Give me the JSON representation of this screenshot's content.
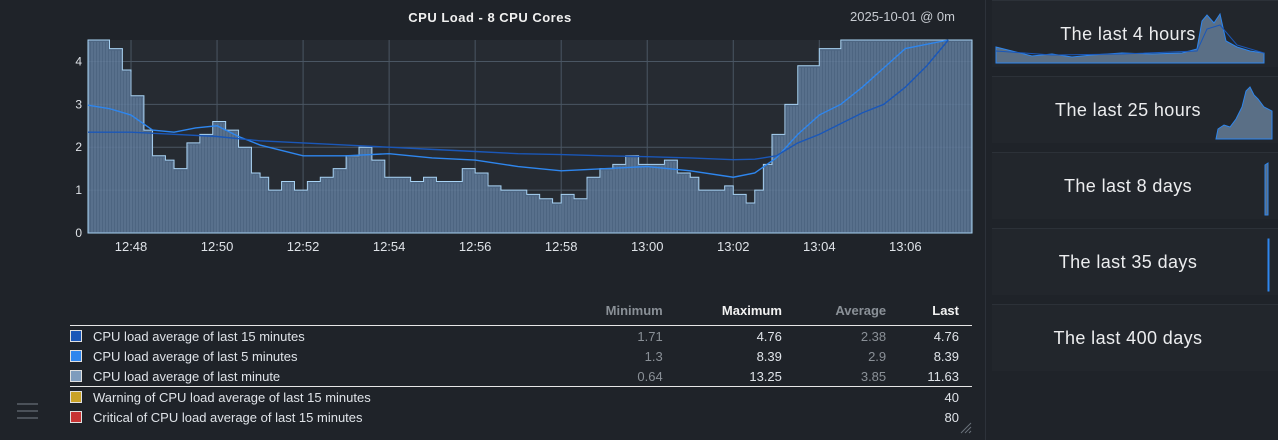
{
  "header": {
    "title": "CPU Load - 8 CPU Cores",
    "timestamp": "2025-10-01 @ 0m"
  },
  "colors": {
    "load15": "#1a57b8",
    "load5": "#2e86ee",
    "load1_line": "#a9d4f5",
    "load1_fill": "#55708f",
    "grid": "#4a5663",
    "warning": "#e2b824",
    "critical": "#d94040"
  },
  "legend": {
    "columns": {
      "name": "",
      "min": "Minimum",
      "max": "Maximum",
      "avg": "Average",
      "last": "Last"
    },
    "rows": [
      {
        "name": "CPU load average of last 15 minutes",
        "min": "1.71",
        "max": "4.76",
        "avg": "2.38",
        "last": "4.76",
        "color": "#1a57b8"
      },
      {
        "name": "CPU load average of last 5 minutes",
        "min": "1.3",
        "max": "8.39",
        "avg": "2.9",
        "last": "8.39",
        "color": "#2e86ee"
      },
      {
        "name": "CPU load average of last minute",
        "min": "0.64",
        "max": "13.25",
        "avg": "3.85",
        "last": "11.63",
        "color": "#7f9cbd"
      }
    ],
    "thresholds": [
      {
        "name": "Warning of CPU load average of last 15 minutes",
        "last": "40",
        "color": "#c9a227"
      },
      {
        "name": "Critical of CPU load average of last 15 minutes",
        "last": "80",
        "color": "#c83434"
      }
    ]
  },
  "side": {
    "periods": [
      {
        "label": "The last 4 hours"
      },
      {
        "label": "The last 25 hours"
      },
      {
        "label": "The last 8 days"
      },
      {
        "label": "The last 35 days"
      },
      {
        "label": "The last 400 days"
      }
    ]
  },
  "chart_data": {
    "type": "area",
    "title": "CPU Load - 8 CPU Cores",
    "xlabel": "",
    "ylabel": "",
    "x_ticks": [
      "12:48",
      "12:50",
      "12:52",
      "12:54",
      "12:56",
      "12:58",
      "13:00",
      "13:02",
      "13:04",
      "13:06"
    ],
    "y_ticks": [
      0,
      1,
      2,
      3,
      4
    ],
    "ylim": [
      0,
      4.5
    ],
    "grid": true,
    "x_unit": "minutes after 12:47",
    "series": [
      {
        "name": "CPU load average of last minute",
        "style": "filled area",
        "x": [
          0,
          0.3,
          0.5,
          0.8,
          1.0,
          1.3,
          1.5,
          1.8,
          2.0,
          2.3,
          2.6,
          2.9,
          3.2,
          3.5,
          3.8,
          4.0,
          4.2,
          4.5,
          4.8,
          5.1,
          5.4,
          5.7,
          6.0,
          6.3,
          6.6,
          6.9,
          7.2,
          7.5,
          7.8,
          8.1,
          8.4,
          8.7,
          9.0,
          9.3,
          9.6,
          9.9,
          10.2,
          10.5,
          10.8,
          11.0,
          11.3,
          11.6,
          11.9,
          12.2,
          12.5,
          12.8,
          13.1,
          13.4,
          13.7,
          14.0,
          14.2,
          14.5,
          14.8,
          15.0,
          15.3,
          15.5,
          15.7,
          15.9,
          16.2,
          16.5,
          17.0,
          17.5,
          18.0,
          19.0,
          20.0,
          20.5
        ],
        "values": [
          4.5,
          4.5,
          4.3,
          3.8,
          3.2,
          2.4,
          1.8,
          1.7,
          1.5,
          2.1,
          2.3,
          2.6,
          2.4,
          2.0,
          1.4,
          1.3,
          1.0,
          1.2,
          1.0,
          1.2,
          1.3,
          1.5,
          1.8,
          2.0,
          1.7,
          1.3,
          1.3,
          1.2,
          1.3,
          1.2,
          1.2,
          1.5,
          1.4,
          1.1,
          1.0,
          1.0,
          0.9,
          0.8,
          0.7,
          0.9,
          0.8,
          1.3,
          1.5,
          1.6,
          1.8,
          1.6,
          1.6,
          1.7,
          1.4,
          1.3,
          1.0,
          1.0,
          1.1,
          0.9,
          0.7,
          1.0,
          1.6,
          2.3,
          3.0,
          3.9,
          4.3,
          4.5,
          4.5,
          4.5,
          4.5,
          4.5
        ]
      },
      {
        "name": "CPU load average of last 5 minutes",
        "style": "line",
        "x": [
          0,
          0.5,
          1.0,
          1.5,
          2.0,
          2.5,
          3.0,
          3.5,
          4.0,
          5.0,
          6.0,
          7.0,
          8.0,
          9.0,
          10.0,
          11.0,
          12.0,
          13.0,
          14.0,
          15.0,
          15.5,
          16.0,
          16.5,
          17.0,
          17.5,
          18.0,
          18.5,
          19.0,
          20.0
        ],
        "values": [
          2.98,
          2.9,
          2.75,
          2.4,
          2.35,
          2.45,
          2.5,
          2.25,
          2.05,
          1.8,
          1.8,
          1.85,
          1.75,
          1.7,
          1.55,
          1.45,
          1.5,
          1.55,
          1.45,
          1.3,
          1.4,
          1.75,
          2.3,
          2.75,
          3.0,
          3.4,
          3.85,
          4.3,
          4.5
        ]
      },
      {
        "name": "CPU load average of last 15 minutes",
        "style": "line",
        "x": [
          0,
          1.0,
          2.0,
          3.0,
          4.0,
          5.0,
          6.0,
          7.0,
          8.0,
          9.0,
          10.0,
          11.0,
          12.0,
          13.0,
          14.0,
          15.0,
          15.5,
          16.0,
          16.5,
          17.0,
          17.5,
          18.0,
          18.5,
          19.0,
          19.5,
          20.0
        ],
        "values": [
          2.35,
          2.35,
          2.3,
          2.25,
          2.15,
          2.1,
          2.05,
          2.0,
          1.95,
          1.9,
          1.85,
          1.83,
          1.8,
          1.78,
          1.75,
          1.71,
          1.72,
          1.8,
          2.1,
          2.3,
          2.55,
          2.8,
          3.0,
          3.4,
          3.9,
          4.5
        ]
      }
    ]
  }
}
